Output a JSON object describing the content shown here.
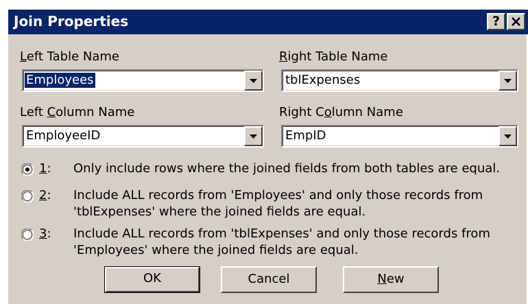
{
  "dialog": {
    "title": "Join Properties",
    "help_label": "?",
    "close_label": "✕"
  },
  "left_table": {
    "label_key": "L",
    "label_rest": "eft Table Name",
    "value": "Employees"
  },
  "right_table": {
    "label_key": "R",
    "label_rest": "ight Table Name",
    "value": "tblExpenses"
  },
  "left_column": {
    "label_pre": "Left ",
    "label_key": "C",
    "label_rest": "olumn Name",
    "value": "EmployeeID"
  },
  "right_column": {
    "label_pre": "Right C",
    "label_key": "o",
    "label_rest": "lumn Name",
    "value": "EmpID"
  },
  "options": [
    {
      "key": "1",
      "suffix": ":",
      "text": "Only include rows where the joined fields from both tables are equal.",
      "selected": true
    },
    {
      "key": "2",
      "suffix": ":",
      "text_line1": "Include ALL records from 'Employees' and only those records from",
      "text_line2": "'tblExpenses' where the joined fields are equal.",
      "selected": false
    },
    {
      "key": "3",
      "suffix": ":",
      "text_line1": "Include ALL records from 'tblExpenses' and only those records from",
      "text_line2": "'Employees' where the joined fields are equal.",
      "selected": false
    }
  ],
  "buttons": {
    "ok": "OK",
    "cancel": "Cancel",
    "new_key": "N",
    "new_rest": "ew"
  },
  "colors": {
    "titlebar": "#0a246a",
    "face": "#d4d0c8",
    "selection": "#0a246a"
  }
}
